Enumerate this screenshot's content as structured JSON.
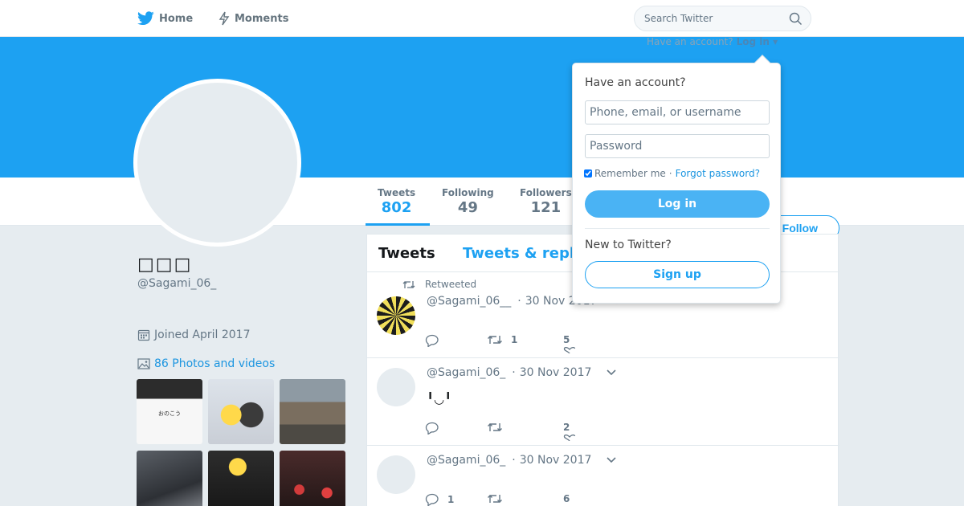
{
  "nav": {
    "home_label": "Home",
    "moments_label": "Moments",
    "search_placeholder": "Search Twitter"
  },
  "header": {
    "have_account_text": "Have an account?",
    "login_link": "Log in"
  },
  "stats": [
    {
      "label": "Tweets",
      "value": "802"
    },
    {
      "label": "Following",
      "value": "49"
    },
    {
      "label": "Followers",
      "value": "121"
    }
  ],
  "follow_button": "Follow",
  "profile": {
    "name": "□□□",
    "handle": "@Sagami_06_",
    "joined": "Joined April 2017",
    "photos_link": "86 Photos and videos",
    "thumb1_caption": "おのこう"
  },
  "timeline": {
    "tabs": [
      "Tweets",
      "Tweets & repl"
    ],
    "tweets": [
      {
        "retweet_label": "Retweeted",
        "handle": "@Sagami_06__",
        "date": "30 Nov 2017",
        "text": "",
        "replies": "",
        "retweets": "1",
        "likes": "5"
      },
      {
        "handle": "@Sagami_06_",
        "date": "30 Nov 2017",
        "text": "╹◡╹",
        "replies": "",
        "retweets": "",
        "likes": "2"
      },
      {
        "handle": "@Sagami_06_",
        "date": "30 Nov 2017",
        "text": "",
        "replies": "1",
        "retweets": "",
        "likes": "6"
      }
    ]
  },
  "login_dropdown": {
    "title": "Have an account?",
    "username_placeholder": "Phone, email, or username",
    "password_placeholder": "Password",
    "remember_label": "Remember me",
    "separator": "·",
    "forgot_link": "Forgot password?",
    "login_button": "Log in",
    "new_title": "New to Twitter?",
    "signup_button": "Sign up"
  },
  "colors": {
    "brand_blue": "#1da1f2",
    "link_blue": "#1b95e0",
    "background": "#e6ecf0"
  },
  "icons": [
    "twitter-bird-icon",
    "lightning-icon",
    "search-icon",
    "calendar-icon",
    "image-icon",
    "retweet-icon",
    "reply-icon",
    "heart-icon",
    "chevron-down-icon"
  ]
}
